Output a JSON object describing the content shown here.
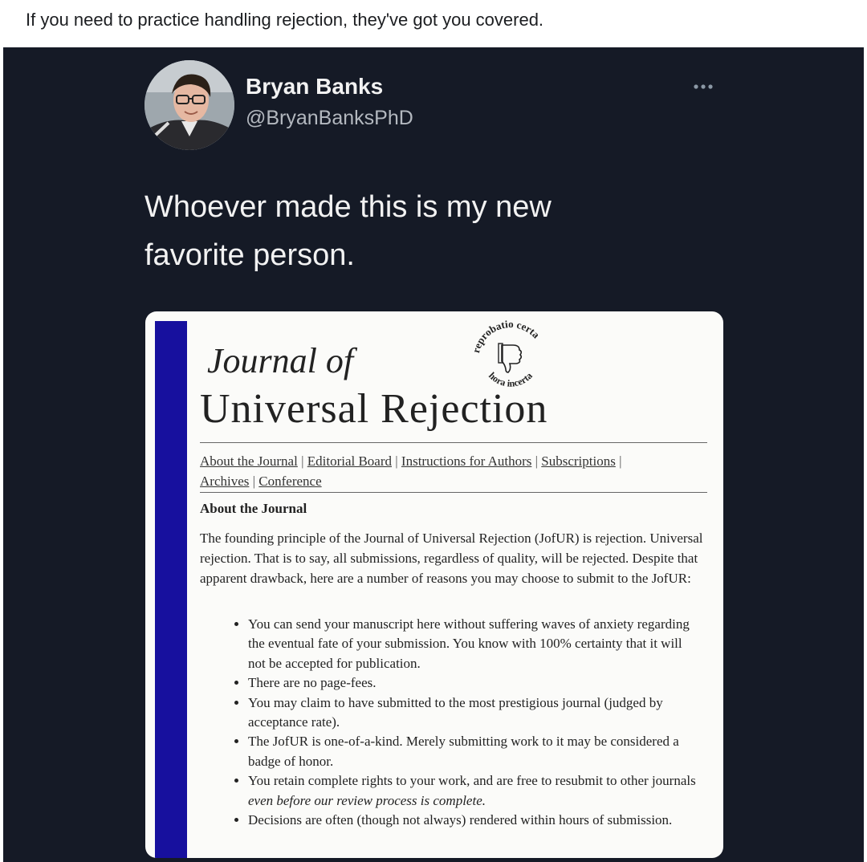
{
  "post": {
    "caption": "If you need to practice handling rejection, they've got you covered."
  },
  "tweet": {
    "author_name": "Bryan Banks",
    "author_handle": "@BryanBanksPhD",
    "more_icon": "more-horizontal-icon",
    "text_line1": "Whoever made this is my new",
    "text_line2": "favorite person."
  },
  "journal": {
    "title_line1": "Journal of",
    "title_line2": "Universal Rejection",
    "seal_top_text": "reprobatio certa",
    "seal_bottom_text": "hora incerta",
    "seal_icon": "thumbs-down-icon",
    "nav": [
      "About the Journal",
      "Editorial Board",
      "Instructions for Authors",
      "Subscriptions",
      "Archives",
      "Conference"
    ],
    "section_heading": "About the Journal",
    "intro": "The founding principle of the Journal of Universal Rejection (JofUR) is rejection. Universal rejection. That is to say, all submissions, regardless of quality, will be rejected. Despite that apparent drawback, here are a number of reasons you may choose to submit to the JofUR:",
    "bullets": [
      "You can send your manuscript here without suffering waves of anxiety regarding the eventual fate of your submission. You know with 100% certainty that it will not be accepted for publication.",
      "There are no page-fees.",
      "You may claim to have submitted to the most prestigious journal (judged by acceptance rate).",
      "The JofUR is one-of-a-kind. Merely submitting work to it may be considered a badge of honor.",
      "You retain complete rights to your work, and are free to resubmit to other journals ",
      "even before our review process is complete.",
      "Decisions are often (though not always) rendered within hours of submission."
    ]
  },
  "colors": {
    "tweet_background": "#151a26",
    "journal_bar": "#17109e"
  }
}
